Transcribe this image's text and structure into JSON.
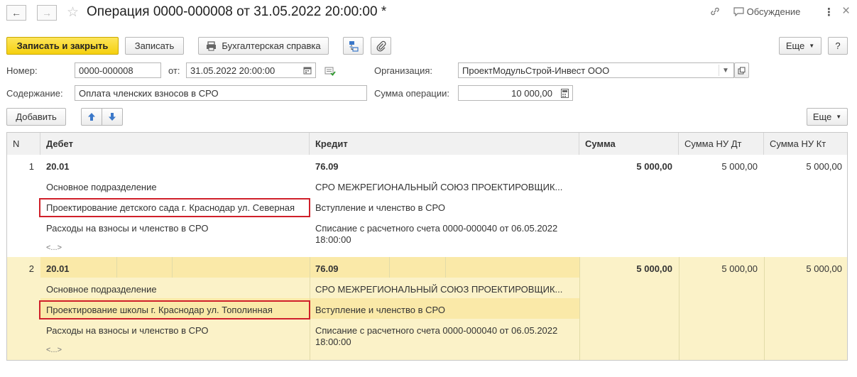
{
  "header": {
    "title": "Операция 0000-000008 от 31.05.2022 20:00:00 *",
    "discussion_label": "Обсуждение",
    "more_dots": "⋮",
    "close": "×"
  },
  "toolbar": {
    "save_close_label": "Записать и закрыть",
    "save_label": "Записать",
    "report_label": "Бухгалтерская справка",
    "more_label": "Еще",
    "help_label": "?"
  },
  "form": {
    "number_label": "Номер:",
    "number_value": "0000-000008",
    "date_label": "от:",
    "date_value": "31.05.2022 20:00:00",
    "org_label": "Организация:",
    "org_value": "ПроектМодульСтрой-Инвест ООО",
    "content_label": "Содержание:",
    "content_value": "Оплата членских взносов в СРО",
    "sum_label": "Сумма операции:",
    "sum_value": "10 000,00"
  },
  "table_toolbar": {
    "add_label": "Добавить",
    "more_label": "Еще"
  },
  "table": {
    "columns": [
      "N",
      "Дебет",
      "Кредит",
      "Сумма",
      "Сумма НУ Дт",
      "Сумма НУ Кт"
    ],
    "rows": [
      {
        "n": "1",
        "debit_account": "20.01",
        "debit_sub1": "Основное подразделение",
        "debit_sub2": "Проектирование детского сада г. Краснодар ул. Северная",
        "debit_sub3": "Расходы на взносы и членство в СРО",
        "debit_more": "<...>",
        "credit_account": "76.09",
        "credit_sub1": "СРО МЕЖРЕГИОНАЛЬНЫЙ СОЮЗ ПРОЕКТИРОВЩИК...",
        "credit_sub2": "Вступление и членство в СРО",
        "credit_sub3_line1": "Списание с расчетного счета 0000-000040 от 06.05.2022",
        "credit_sub3_line2": "18:00:00",
        "sum": "5 000,00",
        "sum_nu_dt": "5 000,00",
        "sum_nu_kt": "5 000,00"
      },
      {
        "n": "2",
        "debit_account": "20.01",
        "debit_sub1": "Основное подразделение",
        "debit_sub2": "Проектирование школы г. Краснодар ул. Тополинная",
        "debit_sub3": "Расходы на взносы и членство в СРО",
        "debit_more": "<...>",
        "credit_account": "76.09",
        "credit_sub1": "СРО МЕЖРЕГИОНАЛЬНЫЙ СОЮЗ ПРОЕКТИРОВЩИК...",
        "credit_sub2": "Вступление и членство в СРО",
        "credit_sub3_line1": "Списание с расчетного счета 0000-000040 от 06.05.2022",
        "credit_sub3_line2": "18:00:00",
        "sum": "5 000,00",
        "sum_nu_dt": "5 000,00",
        "sum_nu_kt": "5 000,00"
      }
    ]
  },
  "colors": {
    "primary_button": "#f5d00e",
    "selected_row": "#fbf2c8",
    "selected_row_alt": "#fae9a8",
    "highlight_border": "#d0202a"
  }
}
